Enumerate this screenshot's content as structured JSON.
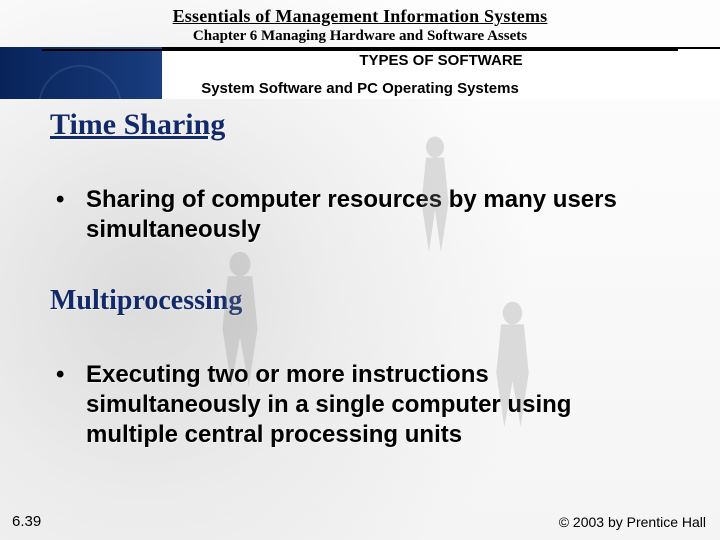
{
  "header": {
    "book_title": "Essentials of Management Information Systems",
    "chapter_title": "Chapter 6 Managing Hardware and Software Assets"
  },
  "section": {
    "title": "TYPES OF SOFTWARE",
    "subtitle": "System Software and PC Operating Systems"
  },
  "content": {
    "heading_1": "Time Sharing",
    "bullet_1": "Sharing of computer resources by many users simultaneously",
    "heading_2": "Multiprocessing",
    "bullet_2": "Executing two or more instructions simultaneously in a single computer using multiple central processing units"
  },
  "footer": {
    "page_number": "6.39",
    "copyright": "© 2003 by Prentice Hall"
  }
}
